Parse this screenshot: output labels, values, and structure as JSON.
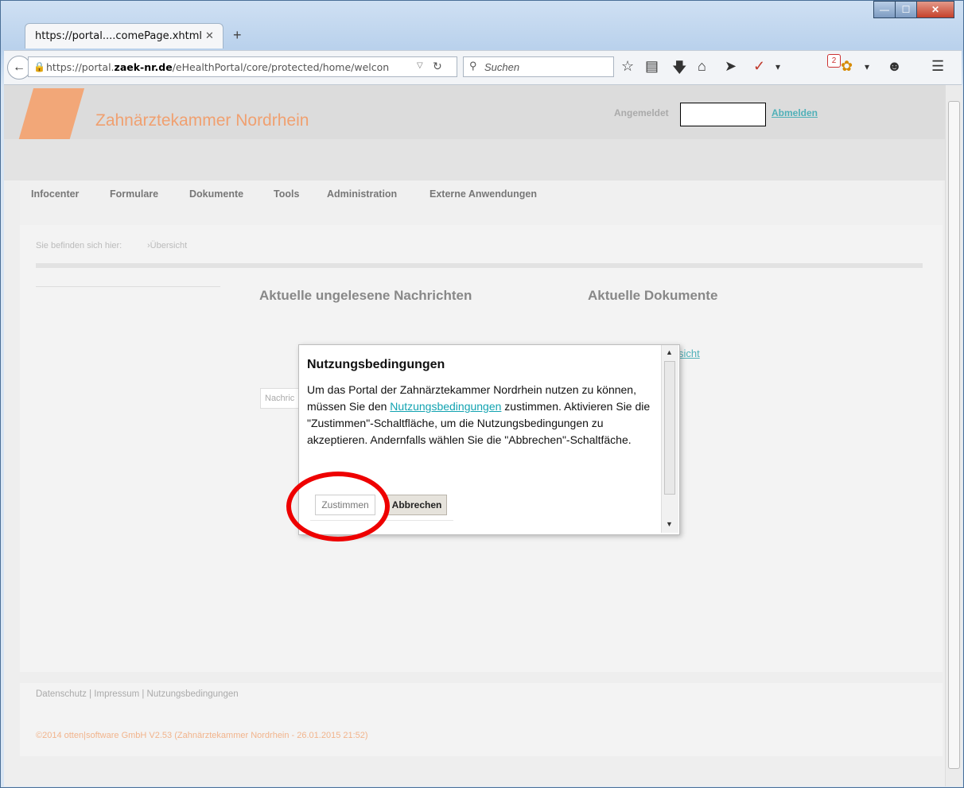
{
  "browser": {
    "tab_title": "https://portal....comePage.xhtml",
    "tab_close": "✕",
    "new_tab": "+",
    "url_prefix": "https://portal.",
    "url_domain": "zaek-nr.de",
    "url_path": "/eHealthPortal/core/protected/home/welcon",
    "search_placeholder": "Suchen",
    "notification_count": "2",
    "window_min": "—",
    "window_max": "☐",
    "window_close": "✕"
  },
  "header": {
    "site_title": "Zahnärztekammer Nordrhein",
    "login_label": "Angemeldet",
    "logout_label": "Abmelden"
  },
  "nav": {
    "items": [
      "Infocenter",
      "Formulare",
      "Dokumente",
      "Tools",
      "Administration",
      "Externe Anwendungen"
    ]
  },
  "content": {
    "breadcrumb_label": "Sie befinden sich hier:",
    "breadcrumb_current": "›Übersicht",
    "messages_heading": "Aktuelle ungelesene Nachrichten",
    "documents_heading": "Aktuelle Dokumente",
    "overview_link": "sicht",
    "messages_input": "Nachric"
  },
  "dialog": {
    "title": "Nutzungsbedingungen",
    "text_before_link": "Um das Portal der Zahnärztekammer Nordrhein nutzen zu können, müssen Sie den ",
    "link": "Nutzungsbedingungen",
    "text_after_link": " zustimmen. Aktivieren Sie die \"Zustimmen\"-Schaltfläche, um die Nutzungsbedingungen zu akzeptieren. Andernfalls wählen Sie die \"Abbrechen\"-Schaltfäche.",
    "agree_label": "Zustimmen",
    "cancel_label": "Abbrechen"
  },
  "footer": {
    "links": "Datenschutz | Impressum | Nutzungsbedingungen",
    "copyright": "©2014 otten|software GmbH V2.53 (Zahnärztekammer Nordrhein - 26.01.2015 21:52)"
  },
  "colors": {
    "brand_orange": "#f0a070",
    "link_teal": "#12a3b1",
    "highlight_red": "#e00000"
  }
}
